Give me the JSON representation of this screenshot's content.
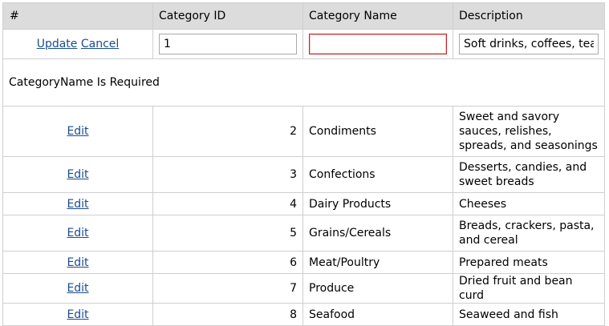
{
  "grid": {
    "columns": [
      "#",
      "Category ID",
      "Category Name",
      "Description"
    ],
    "edit_row": {
      "update_label": "Update",
      "cancel_label": "Cancel",
      "category_id_value": "1",
      "category_name_value": "",
      "description_value": "Soft drinks, coffees, teas, beers, and ales"
    },
    "validation_message": "CategoryName Is Required",
    "edit_label": "Edit",
    "rows": [
      {
        "id": "2",
        "name": "Condiments",
        "description": "Sweet and savory sauces, relishes, spreads, and seasonings"
      },
      {
        "id": "3",
        "name": "Confections",
        "description": "Desserts, candies, and sweet breads"
      },
      {
        "id": "4",
        "name": "Dairy Products",
        "description": "Cheeses"
      },
      {
        "id": "5",
        "name": "Grains/Cereals",
        "description": "Breads, crackers, pasta, and cereal"
      },
      {
        "id": "6",
        "name": "Meat/Poultry",
        "description": "Prepared meats"
      },
      {
        "id": "7",
        "name": "Produce",
        "description": "Dried fruit and bean curd"
      },
      {
        "id": "8",
        "name": "Seafood",
        "description": "Seaweed and fish"
      }
    ],
    "colors": {
      "header_bg": "#dcdcdc",
      "link": "#1a4d8f",
      "invalid_border": "#c0242a"
    }
  }
}
